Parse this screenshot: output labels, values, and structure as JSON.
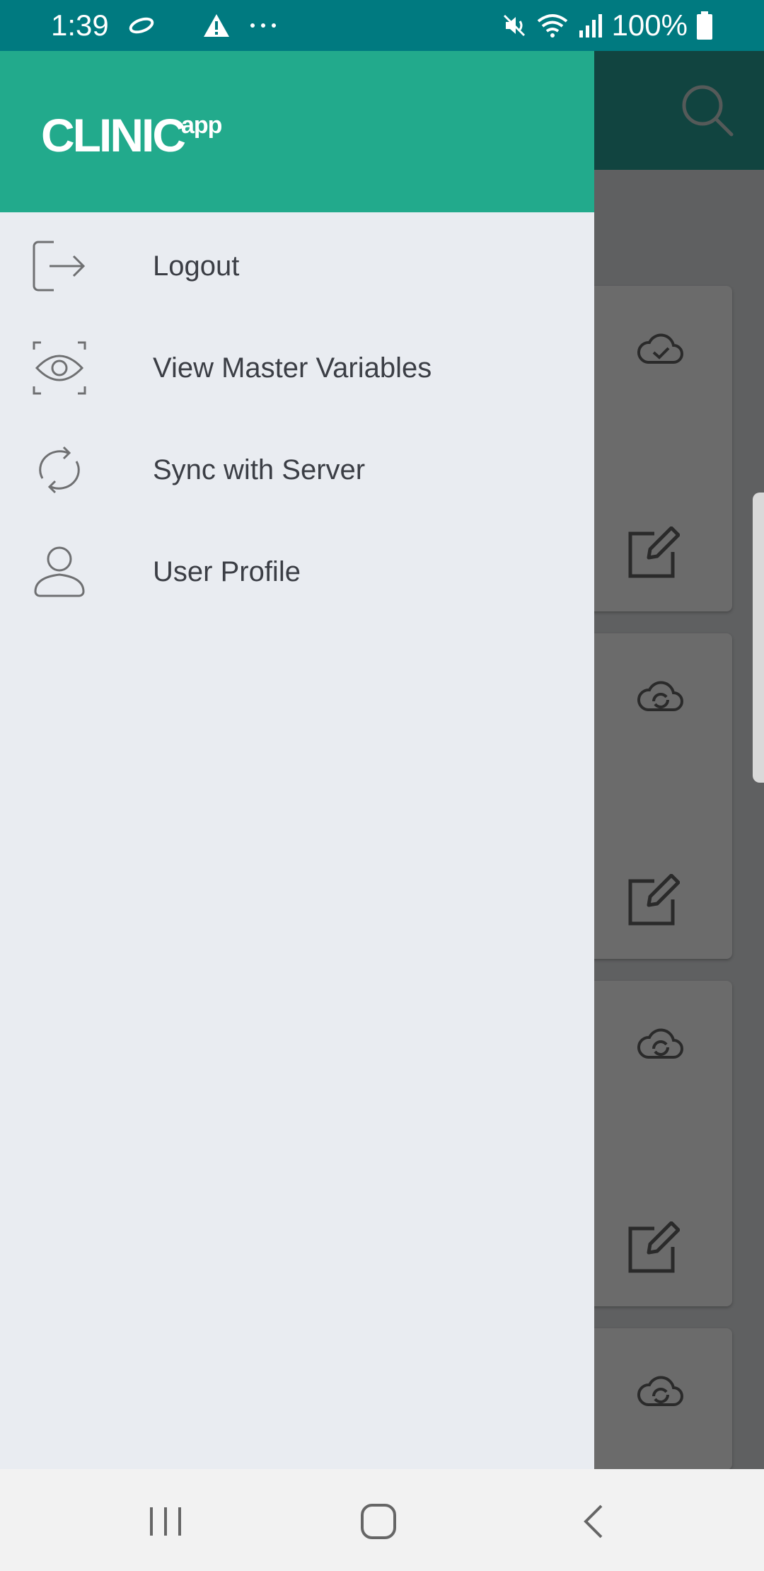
{
  "status_bar": {
    "time": "1:39",
    "battery_percent": "100%",
    "icons": [
      "sync-icon",
      "warning-icon",
      "more-dots-icon",
      "mute-icon",
      "wifi-icon",
      "signal-icon",
      "battery-icon"
    ]
  },
  "drawer": {
    "logo": "CLINICapp",
    "items": [
      {
        "label": "Logout",
        "icon": "logout-icon"
      },
      {
        "label": "View Master Variables",
        "icon": "eye-scan-icon"
      },
      {
        "label": "Sync with Server",
        "icon": "sync-icon"
      },
      {
        "label": "User Profile",
        "icon": "user-icon"
      }
    ]
  },
  "background": {
    "toolbar_icon": "search-icon",
    "cards": [
      {
        "status_icon": "cloud-check-icon",
        "action_icon": "edit-icon"
      },
      {
        "status_icon": "cloud-sync-icon",
        "action_icon": "edit-icon"
      },
      {
        "status_icon": "cloud-sync-icon",
        "action_icon": "edit-icon"
      },
      {
        "status_icon": "cloud-sync-icon"
      }
    ]
  },
  "nav_bar": {
    "buttons": [
      "recent-apps-icon",
      "home-icon",
      "back-icon"
    ]
  },
  "colors": {
    "status_bar": "#007a80",
    "drawer_header": "#22aa8c",
    "drawer_bg": "#e9ecf1",
    "scrim": "#5f6061",
    "menu_text": "#3b3e45"
  }
}
